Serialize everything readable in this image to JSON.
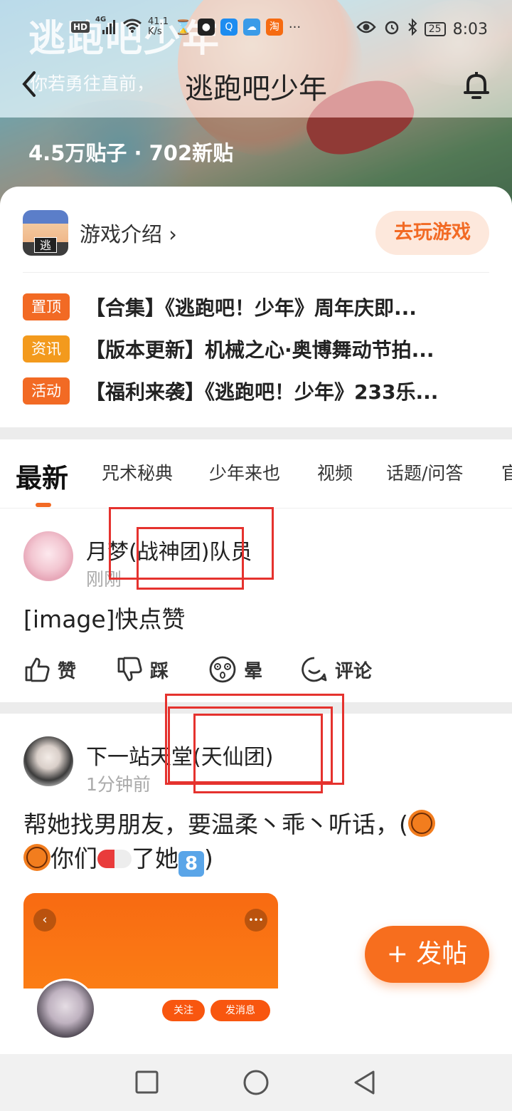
{
  "status_bar": {
    "network_badge": "HD",
    "network_type": "4G",
    "net_speed_value": "41.1",
    "net_speed_unit": "K/s",
    "more": "···",
    "battery": "25",
    "time": "8:03"
  },
  "hero": {
    "watermark_title": "逃跑吧少年",
    "slogan": "你若勇往直前，",
    "stats": "4.5万贴子 · 702新贴"
  },
  "nav": {
    "back": "‹",
    "title": "逃跑吧少年"
  },
  "card": {
    "game_icon_text": "逃",
    "game_intro": "游戏介绍 ›",
    "play_button": "去玩游戏",
    "notices": [
      {
        "tag": "置顶",
        "tag_color": "#f26a24",
        "text": "【合集】《逃跑吧！少年》周年庆即..."
      },
      {
        "tag": "资讯",
        "tag_color": "#f39a1d",
        "text": "【版本更新】机械之心·奥博舞动节拍..."
      },
      {
        "tag": "活动",
        "tag_color": "#f26a24",
        "text": "【福利来袭】《逃跑吧！少年》233乐..."
      }
    ]
  },
  "tabs": [
    "最新",
    "咒术秘典",
    "少年来也",
    "视频",
    "话题/问答",
    "官"
  ],
  "posts": [
    {
      "user": "月梦(战神团)队员",
      "time": "刚刚",
      "body": "[image]快点赞",
      "actions": [
        "赞",
        "踩",
        "晕",
        "评论"
      ]
    },
    {
      "user": "下一站天堂(天仙团)",
      "time": "1分钟前",
      "body_line1": "帮她找男朋友，要温柔丶乖丶听话，(",
      "body_line2a": "你们",
      "body_line2b": "了她",
      "body_line2c": ")",
      "emoji_8": "8",
      "preview": {
        "back": "‹",
        "more": "•••",
        "follow": "关注",
        "message": "发消息"
      }
    }
  ],
  "fab": "+ 发帖",
  "colors": {
    "accent": "#f26a24",
    "annotation_red": "#e5322e"
  }
}
